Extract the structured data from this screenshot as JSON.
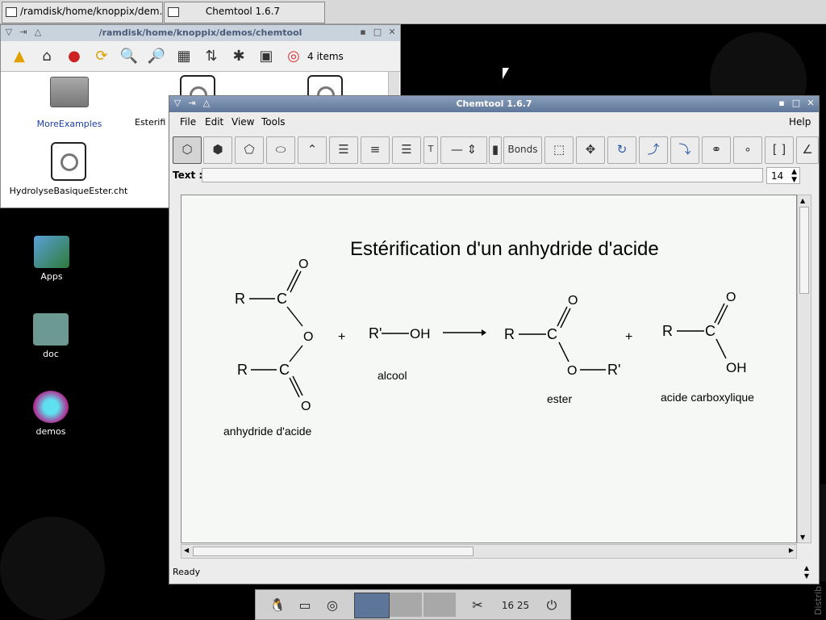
{
  "taskbar_top": {
    "task1": "/ramdisk/home/knoppix/dem...",
    "task2": "Chemtool 1.6.7"
  },
  "file_manager": {
    "title": "/ramdisk/home/knoppix/demos/chemtool",
    "item_count": "4 items",
    "items": [
      "MoreExamples",
      "Esterifi",
      "HydrolyseBasiqueEster.cht"
    ]
  },
  "desktop": {
    "items": [
      "Apps",
      "doc",
      "demos"
    ],
    "side_text": "Distrib"
  },
  "chemtool": {
    "title": "Chemtool 1.6.7",
    "menus": [
      "File",
      "Edit",
      "View",
      "Tools"
    ],
    "help": "Help",
    "bonds_label": "Bonds",
    "text_label": "Text :",
    "text_value": "",
    "font_size": "14",
    "status": "Ready",
    "drawing": {
      "title": "Estérification d'un anhydride d'acide",
      "labels": {
        "R": "R",
        "C": "C",
        "O": "O",
        "OH": "OH",
        "Rp": "R'",
        "plus": "+",
        "anhydride": "anhydride d'acide",
        "alcool": "alcool",
        "ester": "ester",
        "acide": "acide carboxylique"
      }
    }
  },
  "clock": "16 25",
  "colors": {
    "titlebar_active": "#5d7598",
    "titlebar_inactive": "#c9d3de",
    "canvas": "#f6f8f6"
  }
}
